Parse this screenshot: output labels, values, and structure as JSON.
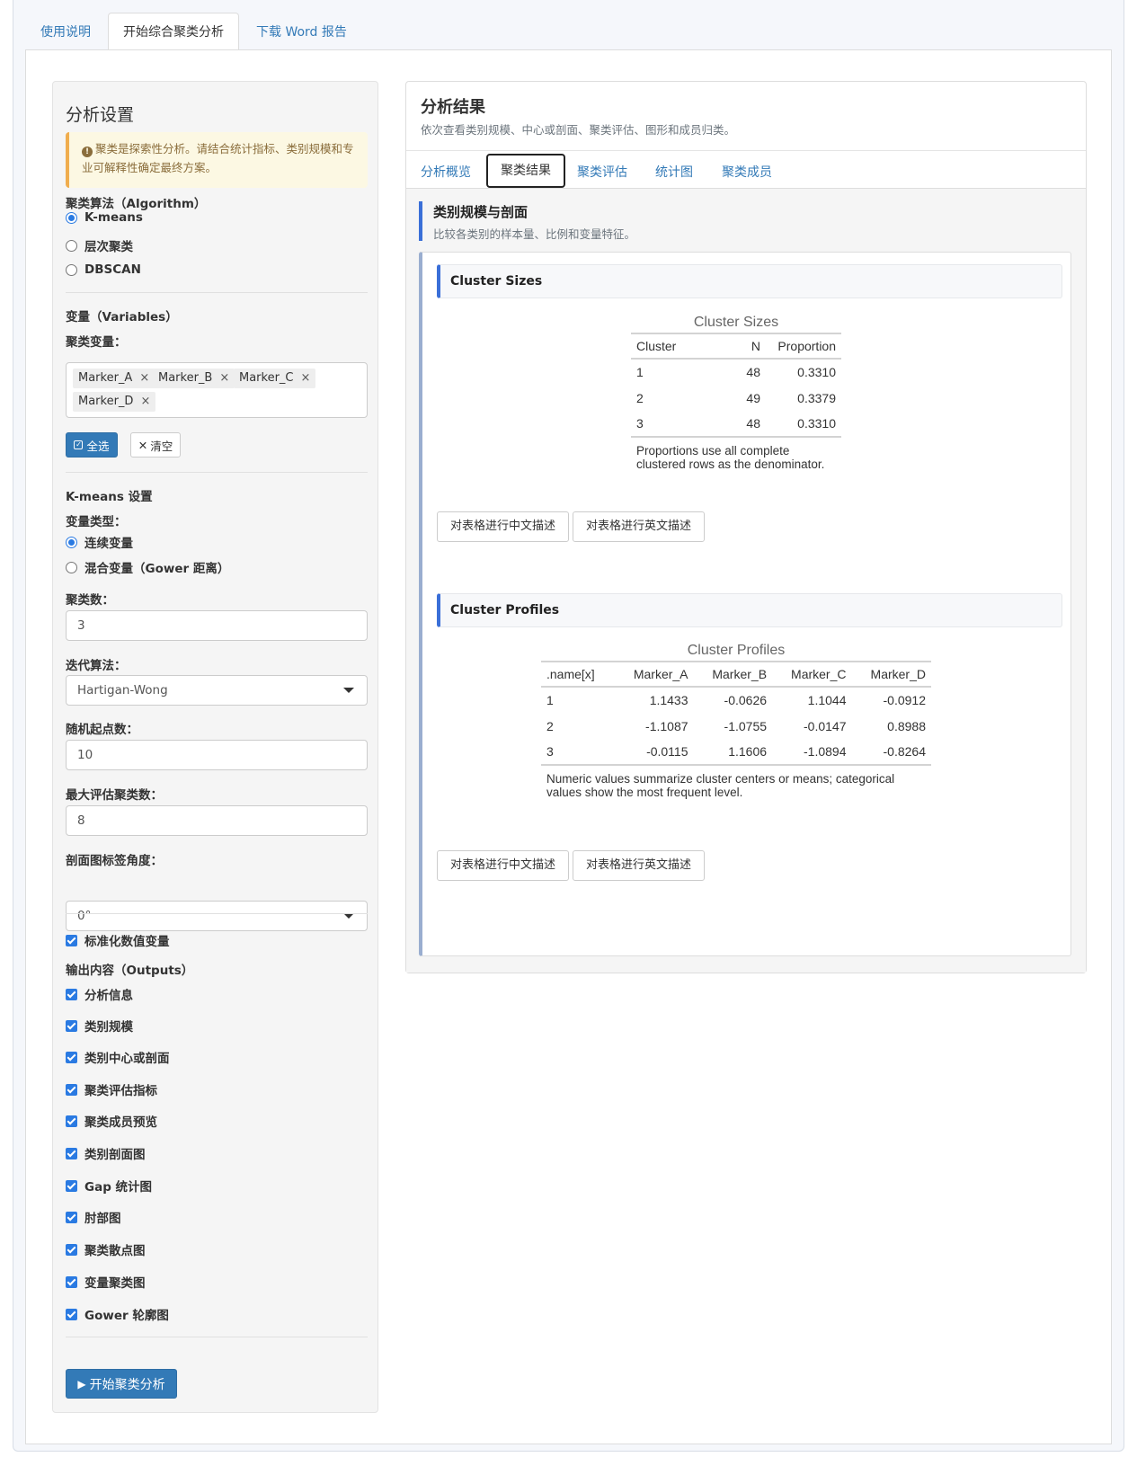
{
  "top_tabs": [
    "使用说明",
    "开始综合聚类分析",
    "下载 Word 报告"
  ],
  "sidebar": {
    "title": "分析设置",
    "warning": "聚类是探索性分析。请结合统计指标、类别规模和专业可解释性确定最终方案。",
    "algorithm_label": "聚类算法（Algorithm）",
    "algorithms": [
      "K-means",
      "层次聚类",
      "DBSCAN"
    ],
    "variables_label": "变量（Variables）",
    "cluster_vars_label": "聚类变量：",
    "tags": [
      "Marker_A",
      "Marker_B",
      "Marker_C",
      "Marker_D"
    ],
    "tag_remove": "×",
    "select_all": "全选",
    "clear": "清空",
    "kmeans_label": "K-means 设置",
    "var_type_label": "变量类型：",
    "var_types": [
      "连续变量",
      "混合变量（Gower 距离）"
    ],
    "k_label": "聚类数：",
    "k_value": "3",
    "iter_label": "迭代算法：",
    "iter_value": "Hartigan-Wong",
    "nstart_label": "随机起点数：",
    "nstart_value": "10",
    "maxk_label": "最大评估聚类数：",
    "maxk_value": "8",
    "angle_label": "剖面图标签角度：",
    "angle_value": "0°",
    "standardize": "标准化数值变量",
    "outputs_label": "输出内容（Outputs）",
    "outputs": [
      "分析信息",
      "类别规模",
      "类别中心或剖面",
      "聚类评估指标",
      "聚类成员预览",
      "类别剖面图",
      "Gap 统计图",
      "肘部图",
      "聚类散点图",
      "变量聚类图",
      "Gower 轮廓图"
    ],
    "run_button": "开始聚类分析"
  },
  "results": {
    "title": "分析结果",
    "subtitle": "依次查看类别规模、中心或剖面、聚类评估、图形和成员归类。",
    "tabs": [
      "分析概览",
      "聚类结果",
      "聚类评估",
      "统计图",
      "聚类成员"
    ],
    "section_title": "类别规模与剖面",
    "section_sub": "比较各类别的样本量、比例和变量特征。",
    "sizes_card": "Cluster Sizes",
    "sizes_table": {
      "caption": "Cluster Sizes",
      "headers": [
        "Cluster",
        "N",
        "Proportion"
      ],
      "rows": [
        [
          "1",
          "48",
          "0.3310"
        ],
        [
          "2",
          "49",
          "0.3379"
        ],
        [
          "3",
          "48",
          "0.3310"
        ]
      ],
      "note": "Proportions use all complete clustered rows as the denominator."
    },
    "profiles_card": "Cluster Profiles",
    "profiles_table": {
      "caption": "Cluster Profiles",
      "headers": [
        ".name[x]",
        "Marker_A",
        "Marker_B",
        "Marker_C",
        "Marker_D"
      ],
      "rows": [
        [
          "1",
          "1.1433",
          "-0.0626",
          "1.1044",
          "-0.0912"
        ],
        [
          "2",
          "-1.1087",
          "-1.0755",
          "-0.0147",
          "0.8988"
        ],
        [
          "3",
          "-0.0115",
          "1.1606",
          "-1.0894",
          "-0.8264"
        ]
      ],
      "note": "Numeric values summarize cluster centers or means; categorical values show the most frequent level."
    },
    "desc_cn": "对表格进行中文描述",
    "desc_en": "对表格进行英文描述"
  }
}
